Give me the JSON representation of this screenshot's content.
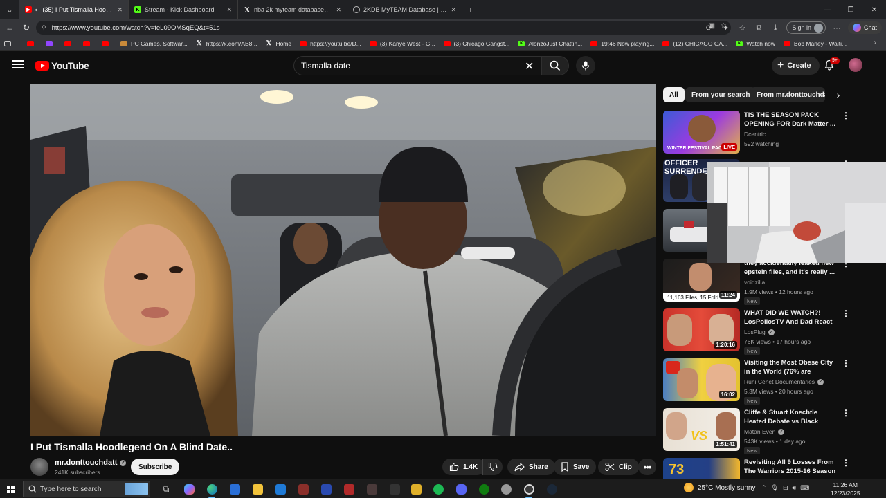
{
  "browser": {
    "tabs": [
      {
        "title": "(35) I Put Tismalla Hoodlegend",
        "icon": "youtube",
        "active": true
      },
      {
        "title": "Stream - Kick Dashboard",
        "icon": "kick",
        "active": false
      },
      {
        "title": "nba 2k myteam database - Search",
        "icon": "x",
        "active": false
      },
      {
        "title": "2KDB MyTEAM Database | NBA 2K",
        "icon": "globe",
        "active": false
      }
    ],
    "new_tab": "+",
    "url": "https://www.youtube.com/watch?v=feL09OMSqEQ&t=51s",
    "sign_in_label": "Sign in",
    "chat_label": "Chat",
    "bookmarks": [
      {
        "label": "",
        "icon": "youtube"
      },
      {
        "label": "",
        "icon": "twitch"
      },
      {
        "label": "",
        "icon": "youtube"
      },
      {
        "label": "",
        "icon": "youtube"
      },
      {
        "label": "",
        "icon": "youtube"
      },
      {
        "label": "PC Games, Softwar...",
        "icon": "globe"
      },
      {
        "label": "https://x.com/AB8...",
        "icon": "x"
      },
      {
        "label": "Home",
        "icon": "x"
      },
      {
        "label": "https://youtu.be/D...",
        "icon": "youtube"
      },
      {
        "label": "(3) Kanye West - G...",
        "icon": "youtube"
      },
      {
        "label": "(3) Chicago Gangst...",
        "icon": "youtube"
      },
      {
        "label": "AlonzoJust Chattin...",
        "icon": "kick"
      },
      {
        "label": "19:46 Now playing...",
        "icon": "youtube"
      },
      {
        "label": "(12) CHICAGO GA...",
        "icon": "youtube"
      },
      {
        "label": "Watch now",
        "icon": "kick"
      },
      {
        "label": "Bob Marley - Waiti...",
        "icon": "youtube"
      }
    ]
  },
  "youtube": {
    "logo_text": "YouTube",
    "search_value": "Tismalla date",
    "create_label": "Create",
    "notifications_badge": "9+",
    "video": {
      "title": "I Put Tismalla Hoodlegend On A Blind Date..",
      "channel": "mr.donttouchdatt",
      "subscribers": "241K subscribers",
      "subscribe_label": "Subscribe",
      "likes": "1.4K",
      "share_label": "Share",
      "save_label": "Save",
      "clip_label": "Clip"
    },
    "chips": [
      "All",
      "From your search",
      "From mr.donttouchdatt"
    ],
    "recommendations": [
      {
        "title": "TIS THE SEASON PACK OPENING FOR Dark Matter ...",
        "channel": "Dcentric",
        "meta": "592 watching",
        "badge": "LIVE",
        "thumb_text": "WINTER FESTIVAL PACK",
        "new": false,
        "verified": false
      },
      {
        "title": "",
        "channel": "",
        "meta": "",
        "badge": "",
        "thumb_text": "OFFICER SURRENDER",
        "new": false,
        "verified": false
      },
      {
        "title": "",
        "channel": "",
        "meta": "",
        "badge": "",
        "thumb_text": "",
        "new": false,
        "verified": false
      },
      {
        "title": "they accidentally leaked new epstein files, and it's really ...",
        "channel": "voidzilla",
        "meta": "1.9M views • 12 hours ago",
        "badge": "11:24",
        "thumb_text": "11,163 Files, 15 Fold",
        "new": true,
        "verified": false
      },
      {
        "title": "WHAT DID WE WATCH?! LosPollosTV And Dad React T...",
        "channel": "LosPlug",
        "meta": "76K views • 17 hours ago",
        "badge": "1:20:16",
        "thumb_text": "",
        "new": true,
        "verified": true
      },
      {
        "title": "Visiting the Most Obese City in the World (76% are overweight)",
        "channel": "Ruhi Cenet Documentaries",
        "meta": "5.3M views • 20 hours ago",
        "badge": "16:02",
        "thumb_text": "",
        "new": true,
        "verified": true
      },
      {
        "title": "Cliffe & Stuart Knechtle Heated Debate vs Black Israelites",
        "channel": "Matan Even",
        "meta": "543K views • 1 day ago",
        "badge": "1:51:41",
        "thumb_text": "VS",
        "new": true,
        "verified": true
      },
      {
        "title": "Revisiting All 9 Losses From The Warriors 2015-16 Season ...",
        "channel": "",
        "meta": "",
        "badge": "",
        "thumb_text": "73",
        "new": false,
        "verified": false
      }
    ],
    "new_label": "New"
  },
  "taskbar": {
    "search_placeholder": "Type here to search",
    "weather": "25°C  Mostly sunny",
    "time": "11:26 AM",
    "date": "12/23/2025"
  },
  "colors": {
    "youtube_red": "#ff0000",
    "kick_green": "#53fc18",
    "background": "#0f0f0f"
  }
}
